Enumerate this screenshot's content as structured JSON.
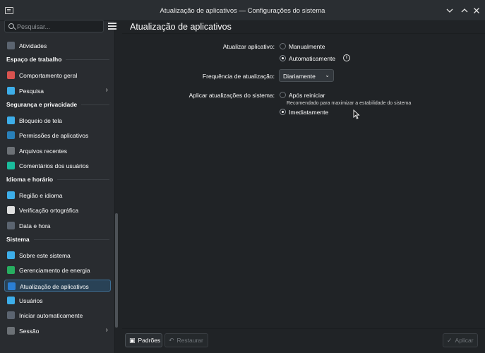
{
  "window": {
    "title": "Atualização de aplicativos — Configurações do sistema",
    "controls": [
      "chevron-down-icon",
      "chevron-up-icon",
      "close-icon"
    ]
  },
  "search": {
    "placeholder": "Pesquisar..."
  },
  "sidebar": {
    "items_top": [
      {
        "label": "Atividades",
        "icon": "activities-icon",
        "color": "#5b6470"
      }
    ],
    "sections": [
      {
        "title": "Espaço de trabalho",
        "items": [
          {
            "label": "Comportamento geral",
            "icon": "general-behavior-icon",
            "color": "#d9534f"
          },
          {
            "label": "Pesquisa",
            "icon": "search-settings-icon",
            "color": "#3daee9",
            "chevron": "›"
          }
        ]
      },
      {
        "title": "Segurança e privacidade",
        "items": [
          {
            "label": "Bloqueio de tela",
            "icon": "screen-lock-icon",
            "color": "#3daee9"
          },
          {
            "label": "Permissões de aplicativos",
            "icon": "app-permissions-icon",
            "color": "#2980b9"
          },
          {
            "label": "Arquivos recentes",
            "icon": "recent-files-icon",
            "color": "#6c7176"
          },
          {
            "label": "Comentários dos usuários",
            "icon": "user-feedback-icon",
            "color": "#1abc9c"
          }
        ]
      },
      {
        "title": "Idioma e horário",
        "items": [
          {
            "label": "Região e idioma",
            "icon": "region-language-icon",
            "color": "#3daee9"
          },
          {
            "label": "Verificação ortográfica",
            "icon": "spell-check-icon",
            "color": "#e0e0e0"
          },
          {
            "label": "Data e hora",
            "icon": "date-time-icon",
            "color": "#5b6470"
          }
        ]
      },
      {
        "title": "Sistema",
        "items": [
          {
            "label": "Sobre este sistema",
            "icon": "about-system-icon",
            "color": "#3daee9"
          },
          {
            "label": "Gerenciamento de energia",
            "icon": "power-management-icon",
            "color": "#27ae60"
          },
          {
            "label": "Atualização de aplicativos",
            "icon": "software-update-icon",
            "color": "#2a7fd4",
            "active": true
          },
          {
            "label": "Usuários",
            "icon": "users-icon",
            "color": "#3daee9"
          },
          {
            "label": "Iniciar automaticamente",
            "icon": "autostart-icon",
            "color": "#5b6470"
          },
          {
            "label": "Sessão",
            "icon": "session-icon",
            "color": "#6c7176",
            "chevron": "›"
          }
        ]
      }
    ]
  },
  "page": {
    "title": "Atualização de aplicativos",
    "update_apply": {
      "label": "Atualizar aplicativo:",
      "options": [
        "Manualmente",
        "Automaticamente"
      ],
      "selected": "Automaticamente",
      "info_icon": "i"
    },
    "frequency": {
      "label": "Frequência de atualização:",
      "value": "Diariamente",
      "caret": "⌄"
    },
    "apply_updates": {
      "label": "Aplicar atualizações do sistema:",
      "options": [
        "Após reiniciar",
        "Imediatamente"
      ],
      "selected": "Imediatamente",
      "hint": "Recomendado para maximizar a estabilidade do sistema"
    }
  },
  "footer": {
    "defaults_label": "Padrões",
    "reset_label": "Restaurar",
    "apply_label": "Aplicar"
  }
}
